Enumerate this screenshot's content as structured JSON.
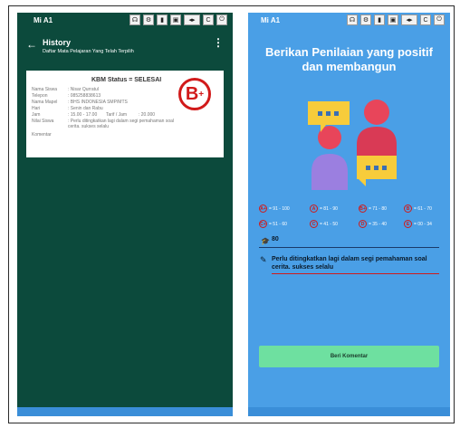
{
  "left_phone": {
    "device": "Mi A1",
    "controls": [
      "☊",
      "⚙",
      "▮",
      "▣",
      "◂▸",
      "C",
      "⏻"
    ],
    "appbar": {
      "title": "History",
      "subtitle": "Daftar Mata Pelajaran Yang Telah Terpilih",
      "back": "←",
      "menu": "⋮"
    },
    "card": {
      "status": "KBM Status = SELESAI",
      "grade_stamp": "B",
      "grade_plus": "+",
      "rows": [
        {
          "k": "Nama Siswa",
          "v": ": Nisar Qurratul"
        },
        {
          "k": "Telepon",
          "v": ": 085258838613"
        },
        {
          "k": "Nama Mapel",
          "v": ": BHS INDONESIA SMP/MTS"
        },
        {
          "k": "Hari",
          "v": ": Senin dan Rabu"
        },
        {
          "k": "Jam",
          "v": ": 15.00 - 17.00",
          "tarif_label": "Tarif / Jam",
          "tarif_value": ": 20.000"
        },
        {
          "k": "Nilai Siswa",
          "v": ": Perlu ditingkatkan lagi dalam segi pemahaman soal cerita. sukses selalu"
        },
        {
          "k": "Komentar",
          "v": ""
        }
      ]
    }
  },
  "right_phone": {
    "device": "Mi A1",
    "controls": [
      "☊",
      "⚙",
      "▮",
      "▣",
      "◂▸",
      "C",
      "⏻"
    ],
    "headline_1": "Berikan Penilaian yang positif",
    "headline_2": "dan membangun",
    "legend": [
      {
        "grade": "A+",
        "range": "= 91 - 100"
      },
      {
        "grade": "A",
        "range": "= 81 - 90"
      },
      {
        "grade": "B+",
        "range": "= 71 - 80"
      },
      {
        "grade": "B",
        "range": "= 61 - 70"
      },
      {
        "grade": "C+",
        "range": "= 51 - 60"
      },
      {
        "grade": "C",
        "range": "= 41 - 50"
      },
      {
        "grade": "D",
        "range": "= 35 - 40"
      },
      {
        "grade": "E",
        "range": "= 00 - 34"
      }
    ],
    "score_icon": "🎓",
    "score": "80",
    "comment_icon": "✎",
    "comment": "Perlu ditingkatkan lagi dalam segi pemahaman soal cerita. sukses selalu",
    "button": "Beri Komentar"
  },
  "colors": {
    "left_bg": "#0c4a3c",
    "right_bg": "#4a9fe6",
    "accent_red": "#d11a1a",
    "button_green": "#6ee0a0"
  }
}
